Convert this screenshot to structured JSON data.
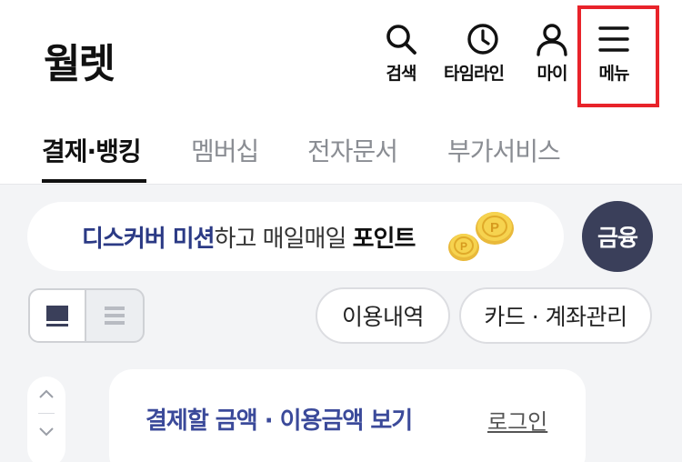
{
  "header": {
    "logo": "월렛",
    "search_label": "검색",
    "timeline_label": "타임라인",
    "my_label": "마이",
    "menu_label": "메뉴"
  },
  "tabs": [
    {
      "label": "결제·뱅킹",
      "active": true
    },
    {
      "label": "멤버십",
      "active": false
    },
    {
      "label": "전자문서",
      "active": false
    },
    {
      "label": "부가서비스",
      "active": false
    }
  ],
  "banner": {
    "part1": "디스커버 미션",
    "part2": "하고 매일매일 ",
    "part3": "포인트"
  },
  "finance_button": "금융",
  "actions": {
    "usage": "이용내역",
    "manage": "카드 · 계좌관리"
  },
  "card": {
    "title": "결제할 금액 · 이용금액 보기",
    "login": "로그인"
  },
  "colors": {
    "highlight": "#e8232a",
    "accent": "#2b3a85",
    "finance_bg": "#3a3f5a",
    "background": "#f3f4f6"
  }
}
